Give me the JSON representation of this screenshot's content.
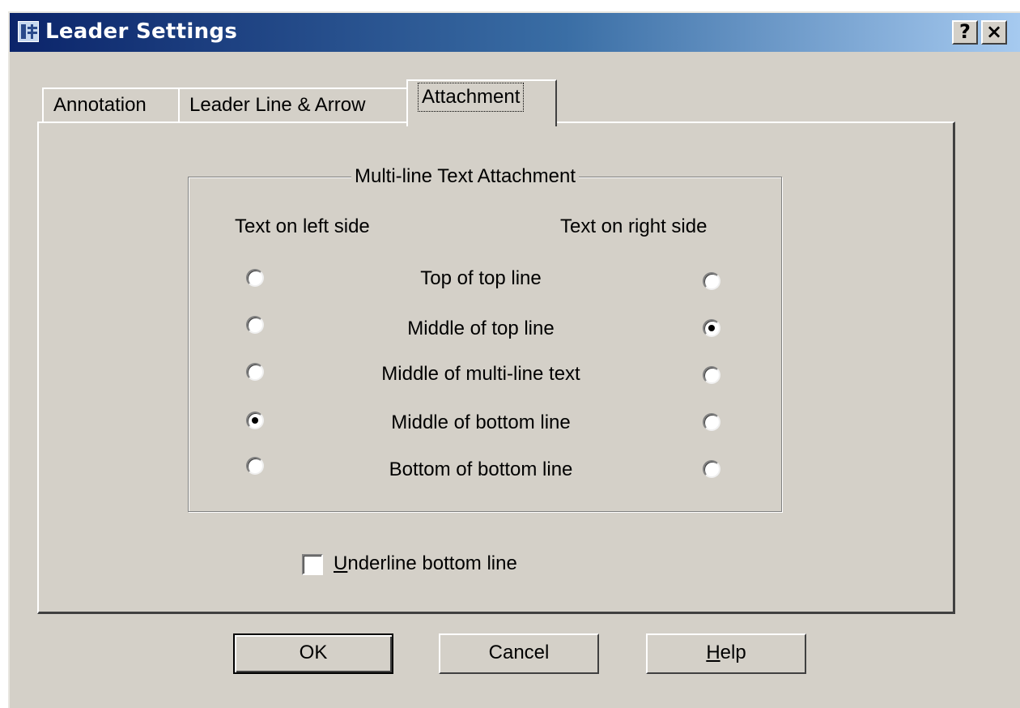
{
  "window": {
    "title": "Leader Settings",
    "help_button": "?",
    "close_button": "×"
  },
  "tabs": [
    {
      "label": "Annotation",
      "selected": false
    },
    {
      "label": "Leader Line & Arrow",
      "selected": false
    },
    {
      "label": "Attachment",
      "selected": true
    }
  ],
  "group": {
    "title": "Multi-line Text Attachment",
    "left_header": "Text on left side",
    "right_header": "Text on right side",
    "options": [
      {
        "label": "Top of top line",
        "left_selected": false,
        "right_selected": false
      },
      {
        "label": "Middle of top line",
        "left_selected": false,
        "right_selected": true
      },
      {
        "label": "Middle of multi-line text",
        "left_selected": false,
        "right_selected": false
      },
      {
        "label": "Middle of bottom line",
        "left_selected": true,
        "right_selected": false
      },
      {
        "label": "Bottom of bottom line",
        "left_selected": false,
        "right_selected": false
      }
    ]
  },
  "underline": {
    "label_first": "U",
    "label_rest": "nderline bottom line",
    "checked": false
  },
  "buttons": {
    "ok": "OK",
    "cancel": "Cancel",
    "help_first": "H",
    "help_rest": "elp"
  },
  "colors": {
    "dialog_face": "#d4d0c8",
    "titlebar_start": "#0b246a",
    "titlebar_end": "#a6caf0"
  }
}
